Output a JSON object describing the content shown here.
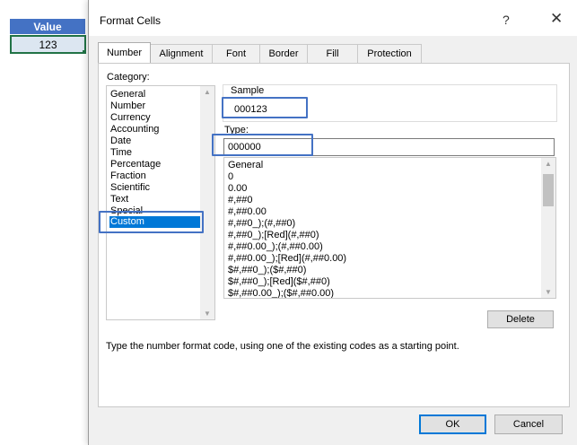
{
  "sheet": {
    "header": "Value",
    "cell_value": "123"
  },
  "dialog": {
    "title": "Format Cells",
    "help": "?",
    "close": "✕",
    "tabs": [
      "Number",
      "Alignment",
      "Font",
      "Border",
      "Fill",
      "Protection"
    ],
    "active_tab": "Number",
    "category_label": "Category:",
    "categories": [
      "General",
      "Number",
      "Currency",
      "Accounting",
      "Date",
      "Time",
      "Percentage",
      "Fraction",
      "Scientific",
      "Text",
      "Special",
      "Custom"
    ],
    "selected_category": "Custom",
    "sample_label": "Sample",
    "sample_value": "000123",
    "type_label": "Type:",
    "type_value": "000000",
    "formats": [
      "General",
      "0",
      "0.00",
      "#,##0",
      "#,##0.00",
      "#,##0_);(#,##0)",
      "#,##0_);[Red](#,##0)",
      "#,##0.00_);(#,##0.00)",
      "#,##0.00_);[Red](#,##0.00)",
      "$#,##0_);($#,##0)",
      "$#,##0_);[Red]($#,##0)",
      "$#,##0.00_);($#,##0.00)"
    ],
    "delete_button": "Delete",
    "hint": "Type the number format code, using one of the existing codes as a starting point.",
    "ok_button": "OK",
    "cancel_button": "Cancel"
  },
  "colors": {
    "accent": "#4472c4",
    "selection": "#0078d7",
    "cell_border": "#217346"
  }
}
